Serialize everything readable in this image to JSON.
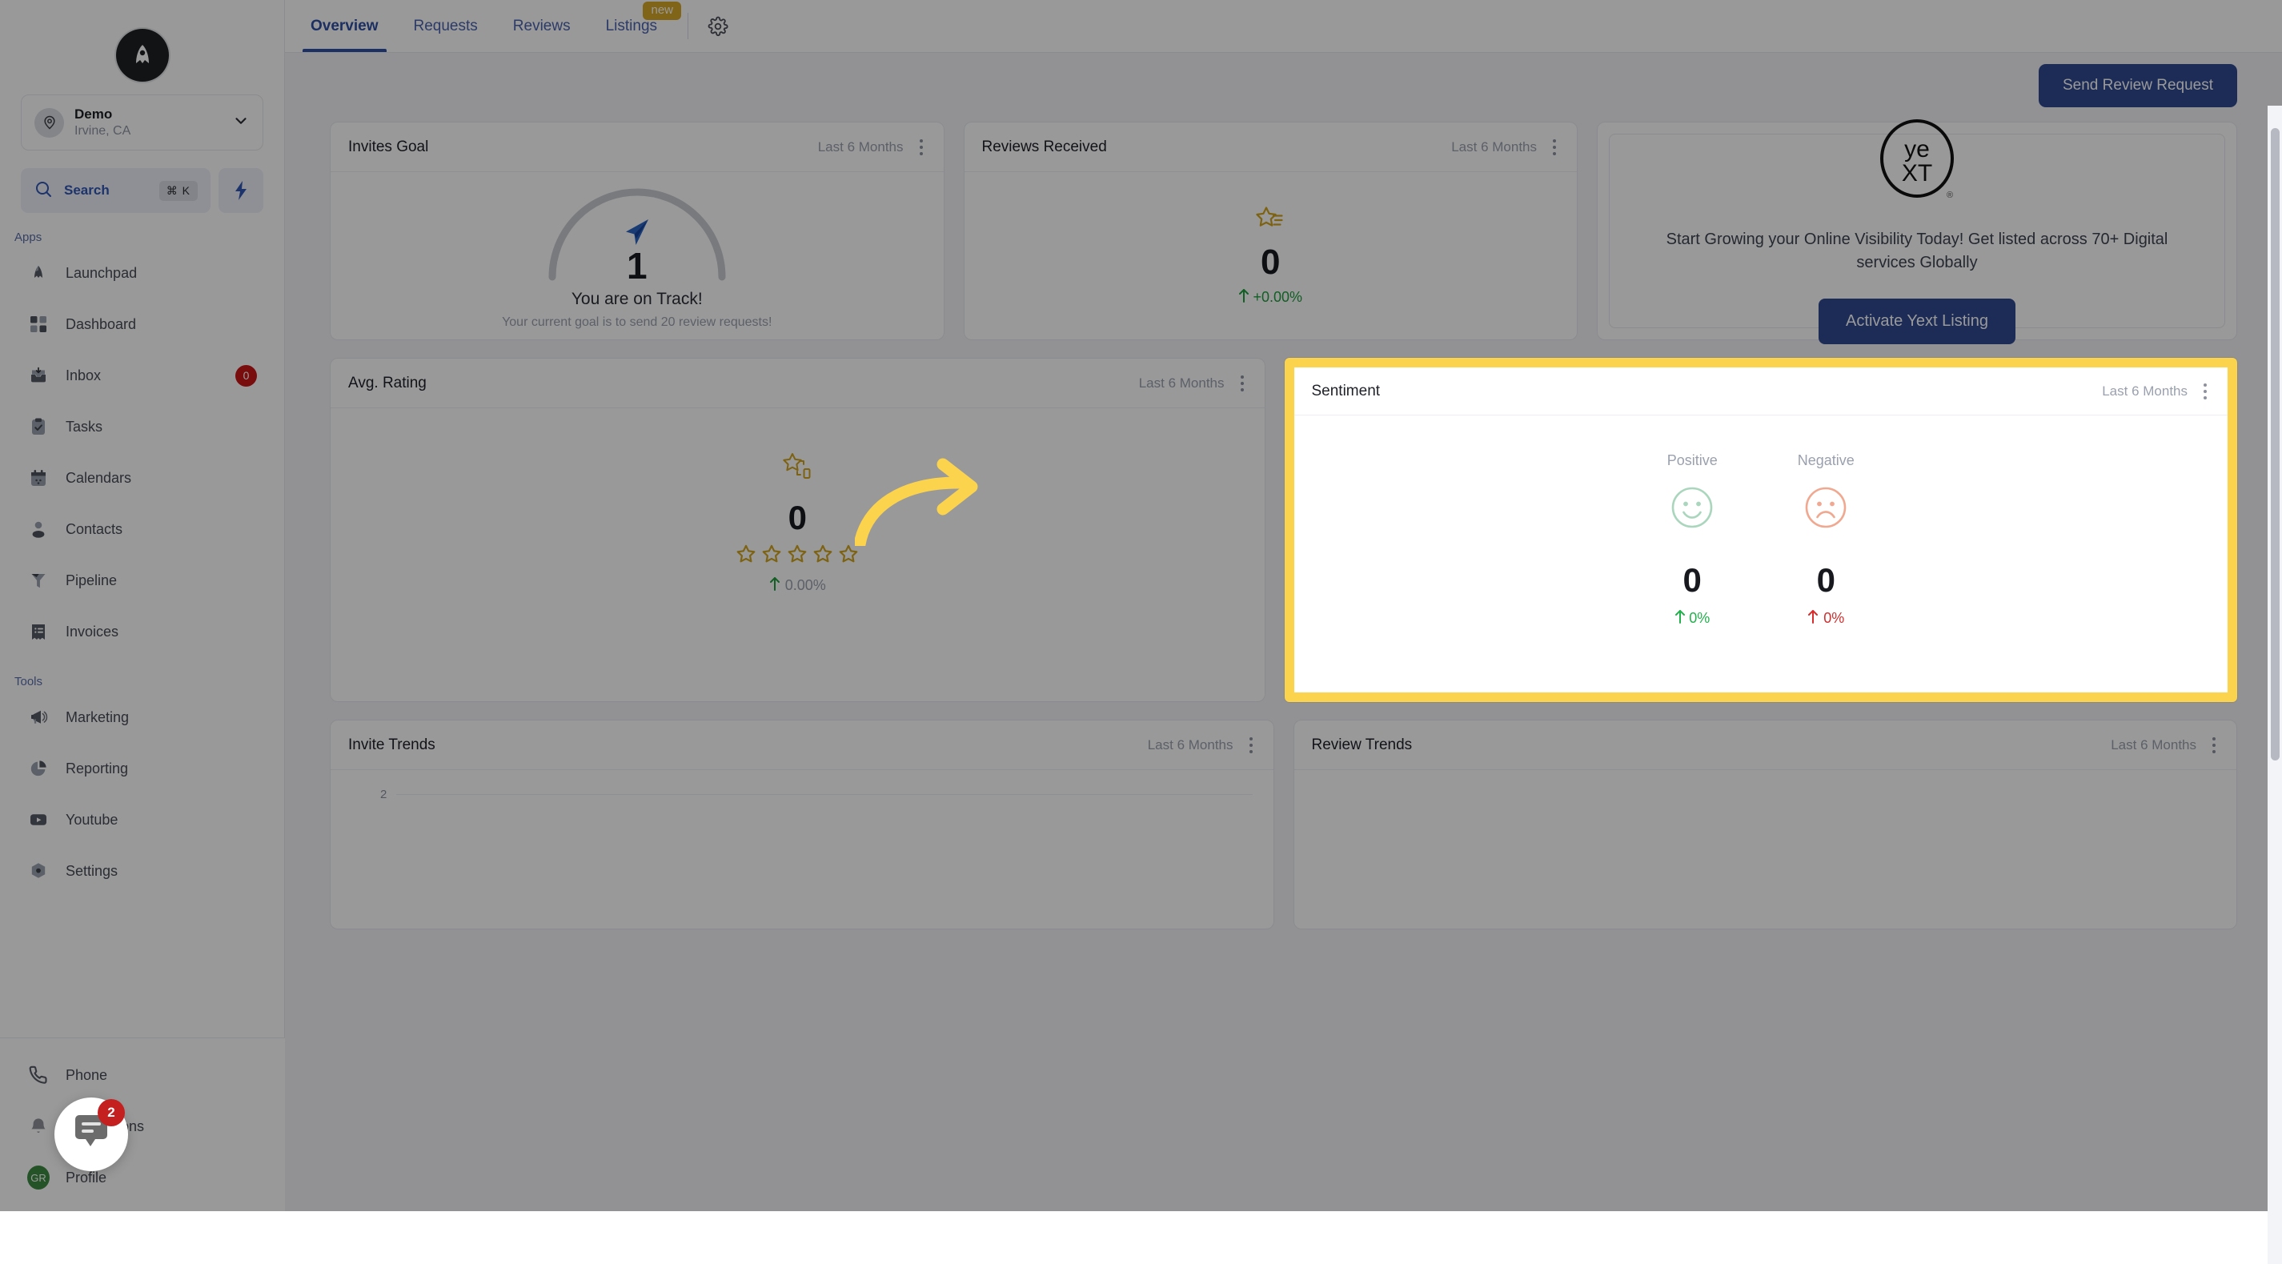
{
  "sidebar": {
    "brand": {
      "icon": "rocket-logo-icon"
    },
    "location": {
      "name": "Demo",
      "sub": "Irvine, CA",
      "avatar_icon": "location-pin-icon",
      "chevron_icon": "chevron-down-icon"
    },
    "search": {
      "label": "Search",
      "shortcut": "⌘ K",
      "icon": "search-icon"
    },
    "quick_action": {
      "icon": "lightning-bolt-icon"
    },
    "sections": [
      {
        "label": "Apps",
        "items": [
          {
            "label": "Launchpad",
            "icon": "rocket-icon"
          },
          {
            "label": "Dashboard",
            "icon": "grid-icon"
          },
          {
            "label": "Inbox",
            "icon": "inbox-icon",
            "badge": "0"
          },
          {
            "label": "Tasks",
            "icon": "clipboard-check-icon"
          },
          {
            "label": "Calendars",
            "icon": "calendar-icon"
          },
          {
            "label": "Contacts",
            "icon": "user-icon"
          },
          {
            "label": "Pipeline",
            "icon": "funnel-icon"
          },
          {
            "label": "Invoices",
            "icon": "invoice-icon"
          }
        ]
      },
      {
        "label": "Tools",
        "items": [
          {
            "label": "Marketing",
            "icon": "megaphone-icon"
          },
          {
            "label": "Reporting",
            "icon": "pie-chart-icon"
          },
          {
            "label": "Youtube",
            "icon": "youtube-icon"
          },
          {
            "label": "Settings",
            "icon": "gear-icon"
          }
        ]
      }
    ],
    "bottom": [
      {
        "label": "Phone",
        "icon": "phone-icon"
      },
      {
        "label": "Notifications",
        "icon": "bell-icon"
      },
      {
        "label": "Profile",
        "icon": "avatar",
        "avatar_initials": "GR"
      }
    ],
    "chat_widget": {
      "badge": "2",
      "icon": "chat-bubble-icon"
    }
  },
  "topbar": {
    "hamburger_icon": "menu-icon",
    "tabs": [
      {
        "label": "Overview",
        "active": true
      },
      {
        "label": "Requests",
        "active": false
      },
      {
        "label": "Reviews",
        "active": false
      },
      {
        "label": "Listings",
        "active": false,
        "badge": "new"
      }
    ],
    "gear_icon": "gear-icon"
  },
  "main": {
    "send_review_request_label": "Send Review Request",
    "range_label": "Last 6 Months",
    "invites_goal": {
      "title": "Invites Goal",
      "range": "Last 6 Months",
      "value": "1",
      "status": "You are on Track!",
      "sub": "Your current goal is to send 20 review requests!",
      "icon": "paper-plane-icon"
    },
    "reviews_received": {
      "title": "Reviews Received",
      "range": "Last 6 Months",
      "value": "0",
      "delta": "+0.00%",
      "delta_direction": "up",
      "icon": "star-lines-icon"
    },
    "yext": {
      "logo_line1": "ye",
      "logo_line2": "XT",
      "registered_mark": "®",
      "text": "Start Growing your Online Visibility Today! Get listed across 70+ Digital services Globally",
      "button_label": "Activate Yext Listing"
    },
    "avg_rating": {
      "title": "Avg. Rating",
      "range": "Last 6 Months",
      "value": "0",
      "stars_total": 5,
      "stars_filled": 0,
      "delta": "0.00%",
      "delta_direction": "up",
      "icon": "star-rating-icon"
    },
    "sentiment": {
      "title": "Sentiment",
      "range": "Last 6 Months",
      "highlighted": true,
      "highlight_color": "#fcd34d",
      "columns": [
        {
          "label": "Positive",
          "icon": "smiley-happy-icon",
          "value": "0",
          "delta": "0%",
          "delta_direction": "up",
          "color": "#22b14c"
        },
        {
          "label": "Negative",
          "icon": "smiley-sad-icon",
          "value": "0",
          "delta": "0%",
          "delta_direction": "up",
          "color": "#d92b2b"
        }
      ]
    },
    "invite_trends": {
      "title": "Invite Trends",
      "range": "Last 6 Months",
      "y_tick": "2"
    },
    "review_trends": {
      "title": "Review Trends",
      "range": "Last 6 Months"
    },
    "annotation_arrow": {
      "icon": "curved-arrow-right-icon",
      "color": "#fcd34d"
    }
  }
}
